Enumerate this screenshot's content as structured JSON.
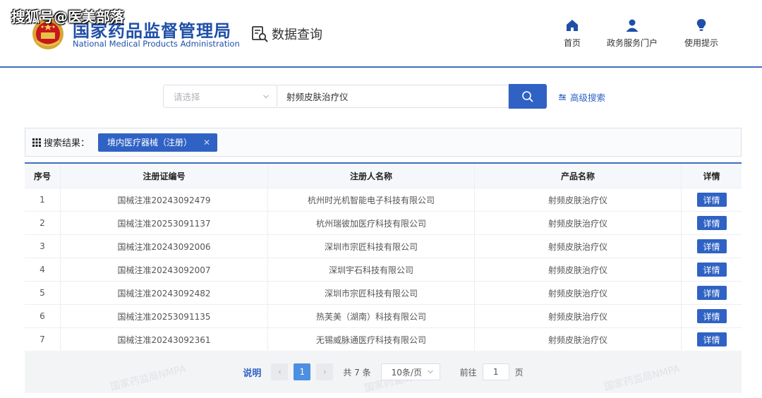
{
  "watermark_top": "搜狐号@医美部落",
  "header": {
    "brand_cn": "国家药品监督管理局",
    "brand_en": "National Medical Products Administration",
    "query_label": "数据查询",
    "nav": [
      {
        "label": "首页",
        "icon": "home-icon"
      },
      {
        "label": "政务服务门户",
        "icon": "user-icon"
      },
      {
        "label": "使用提示",
        "icon": "lightbulb-icon"
      }
    ]
  },
  "search": {
    "select_placeholder": "请选择",
    "query_value": "射频皮肤治疗仪",
    "advanced_label": "高级搜索"
  },
  "results": {
    "label": "搜索结果：",
    "tag": "境内医疗器械（注册）"
  },
  "table": {
    "headers": [
      "序号",
      "注册证编号",
      "注册人名称",
      "产品名称",
      "详情"
    ],
    "rows": [
      {
        "no": "1",
        "reg": "国械注准20243092479",
        "company": "杭州时光机智能电子科技有限公司",
        "product": "射频皮肤治疗仪",
        "action": "详情"
      },
      {
        "no": "2",
        "reg": "国械注准20253091137",
        "company": "杭州瑞彼加医疗科技有限公司",
        "product": "射频皮肤治疗仪",
        "action": "详情"
      },
      {
        "no": "3",
        "reg": "国械注准20243092006",
        "company": "深圳市宗匠科技有限公司",
        "product": "射频皮肤治疗仪",
        "action": "详情"
      },
      {
        "no": "4",
        "reg": "国械注准20243092007",
        "company": "深圳宇石科技有限公司",
        "product": "射频皮肤治疗仪",
        "action": "详情"
      },
      {
        "no": "5",
        "reg": "国械注准20243092482",
        "company": "深圳市宗匠科技有限公司",
        "product": "射频皮肤治疗仪",
        "action": "详情"
      },
      {
        "no": "6",
        "reg": "国械注准20253091135",
        "company": "热芙美（湖南）科技有限公司",
        "product": "射频皮肤治疗仪",
        "action": "详情"
      },
      {
        "no": "7",
        "reg": "国械注准20243092361",
        "company": "无锡威脉通医疗科技有限公司",
        "product": "射频皮肤治疗仪",
        "action": "详情"
      }
    ]
  },
  "pagination": {
    "explain_label": "说明",
    "prev": "‹",
    "current_page": "1",
    "next": "›",
    "total": "共 7 条",
    "page_size": "10条/页",
    "goto_label": "前往",
    "goto_value": "1",
    "page_suffix": "页",
    "watermark": "国家药监局NMPA"
  },
  "colors": {
    "primary": "#2f62c4",
    "brand_text": "#1f4fa8",
    "active_page": "#4d8fe0"
  }
}
